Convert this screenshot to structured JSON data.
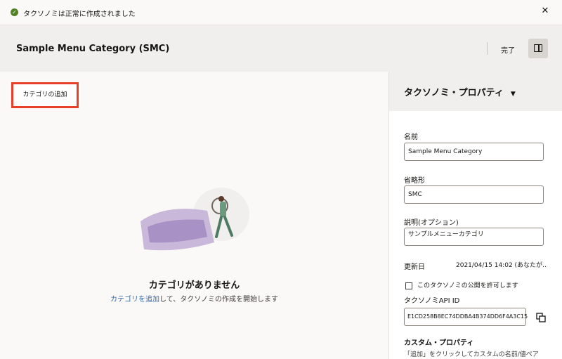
{
  "notification": {
    "message": "タクソノミは正常に作成されました",
    "icon": "check-circle-icon",
    "close_icon": "close-icon"
  },
  "header": {
    "title": "Sample Menu Category (SMC)",
    "done_label": "完了",
    "panel_toggle_icon": "panel-toggle-icon"
  },
  "main": {
    "add_category_label": "カテゴリの追加",
    "empty_title": "カテゴリがありません",
    "empty_link": "カテゴリを追加",
    "empty_rest": "して、タクソノミの作成を開始します"
  },
  "panel": {
    "title": "タクソノミ・プロパティ",
    "caret": "▼",
    "name_label": "名前",
    "name_value": "Sample Menu Category",
    "short_label": "省略形",
    "short_value": "SMC",
    "desc_label": "説明(オプション)",
    "desc_value": "サンプルメニューカテゴリ",
    "updated_label": "更新日",
    "updated_value": "2021/04/15 14:02 (あなたが…",
    "publish_label": "このタクソノミの公開を許可します",
    "api_label": "タクソノミAPI ID",
    "api_value": "E1CD258B8EC74DDBA4B374DD6F4A3C15",
    "custom_label": "カスタム・プロパティ",
    "custom_desc": "「追加」をクリックしてカスタムの名前/値ペア"
  },
  "colors": {
    "accent_red": "#e8402c",
    "link_blue": "#3268a8",
    "success_green": "#508223"
  }
}
